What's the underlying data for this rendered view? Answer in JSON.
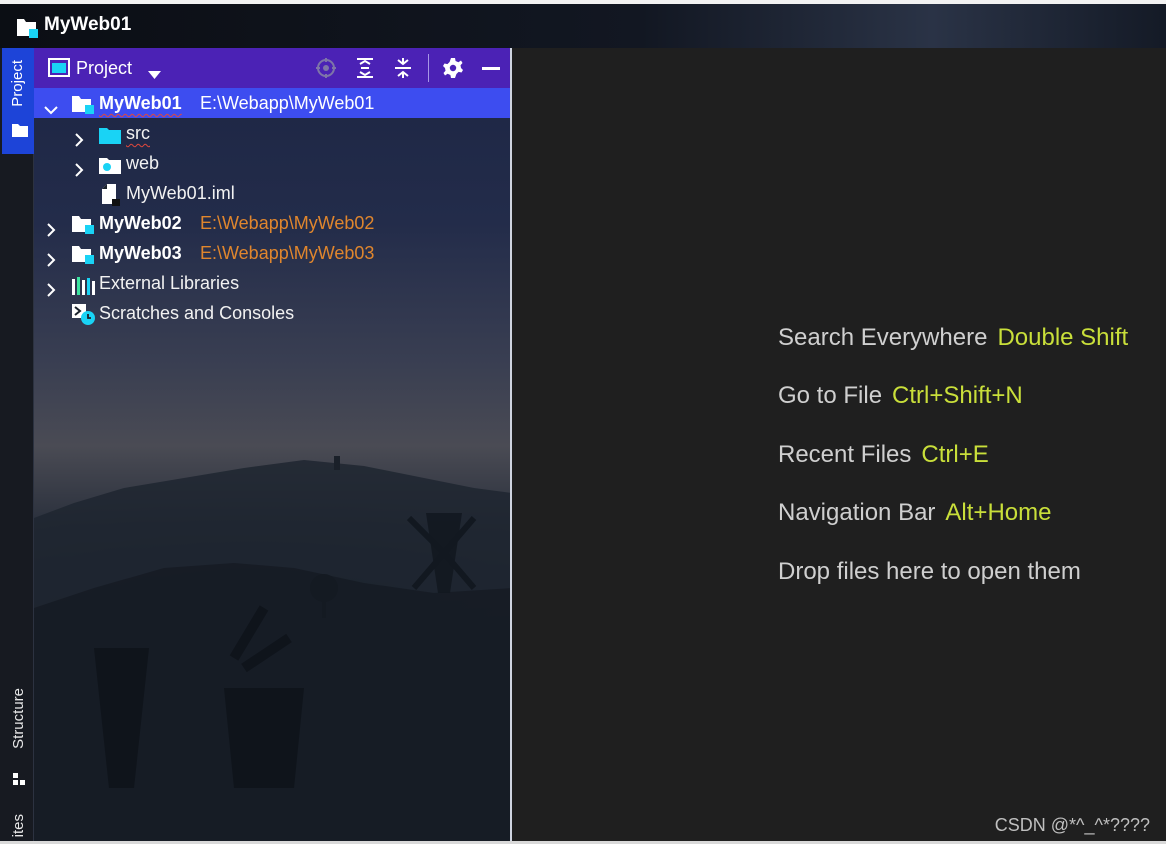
{
  "window": {
    "title": "MyWeb01"
  },
  "tool_strip": {
    "project_label": "Project",
    "structure_label": "Structure",
    "favorites_label": "ites"
  },
  "project_panel": {
    "view_label": "Project",
    "header_buttons": [
      "locate-icon",
      "expand-all-icon",
      "collapse-all-icon",
      "gear-icon",
      "minimize-icon"
    ],
    "tree": [
      {
        "name": "MyWeb01",
        "path": "E:\\Webapp\\MyWeb01",
        "expanded": true,
        "selected": true
      },
      {
        "name": "src"
      },
      {
        "name": "web"
      },
      {
        "name": "MyWeb01.iml"
      },
      {
        "name": "MyWeb02",
        "path": "E:\\Webapp\\MyWeb02"
      },
      {
        "name": "MyWeb03",
        "path": "E:\\Webapp\\MyWeb03"
      },
      {
        "name": "External Libraries"
      },
      {
        "name": "Scratches and Consoles"
      }
    ]
  },
  "editor": {
    "hints": [
      {
        "label": "Search Everywhere",
        "key": "Double Shift"
      },
      {
        "label": "Go to File",
        "key": "Ctrl+Shift+N"
      },
      {
        "label": "Recent Files",
        "key": "Ctrl+E"
      },
      {
        "label": "Navigation Bar",
        "key": "Alt+Home"
      },
      {
        "label": "Drop files here to open them",
        "key": ""
      }
    ],
    "watermark": "CSDN @*^_^*????"
  },
  "colors": {
    "panel_header": "#4b22b5",
    "selection": "#3d4df0",
    "shortcut": "#c9df3a",
    "module_path": "#e0862d",
    "accent_cyan": "#19d3f5"
  }
}
